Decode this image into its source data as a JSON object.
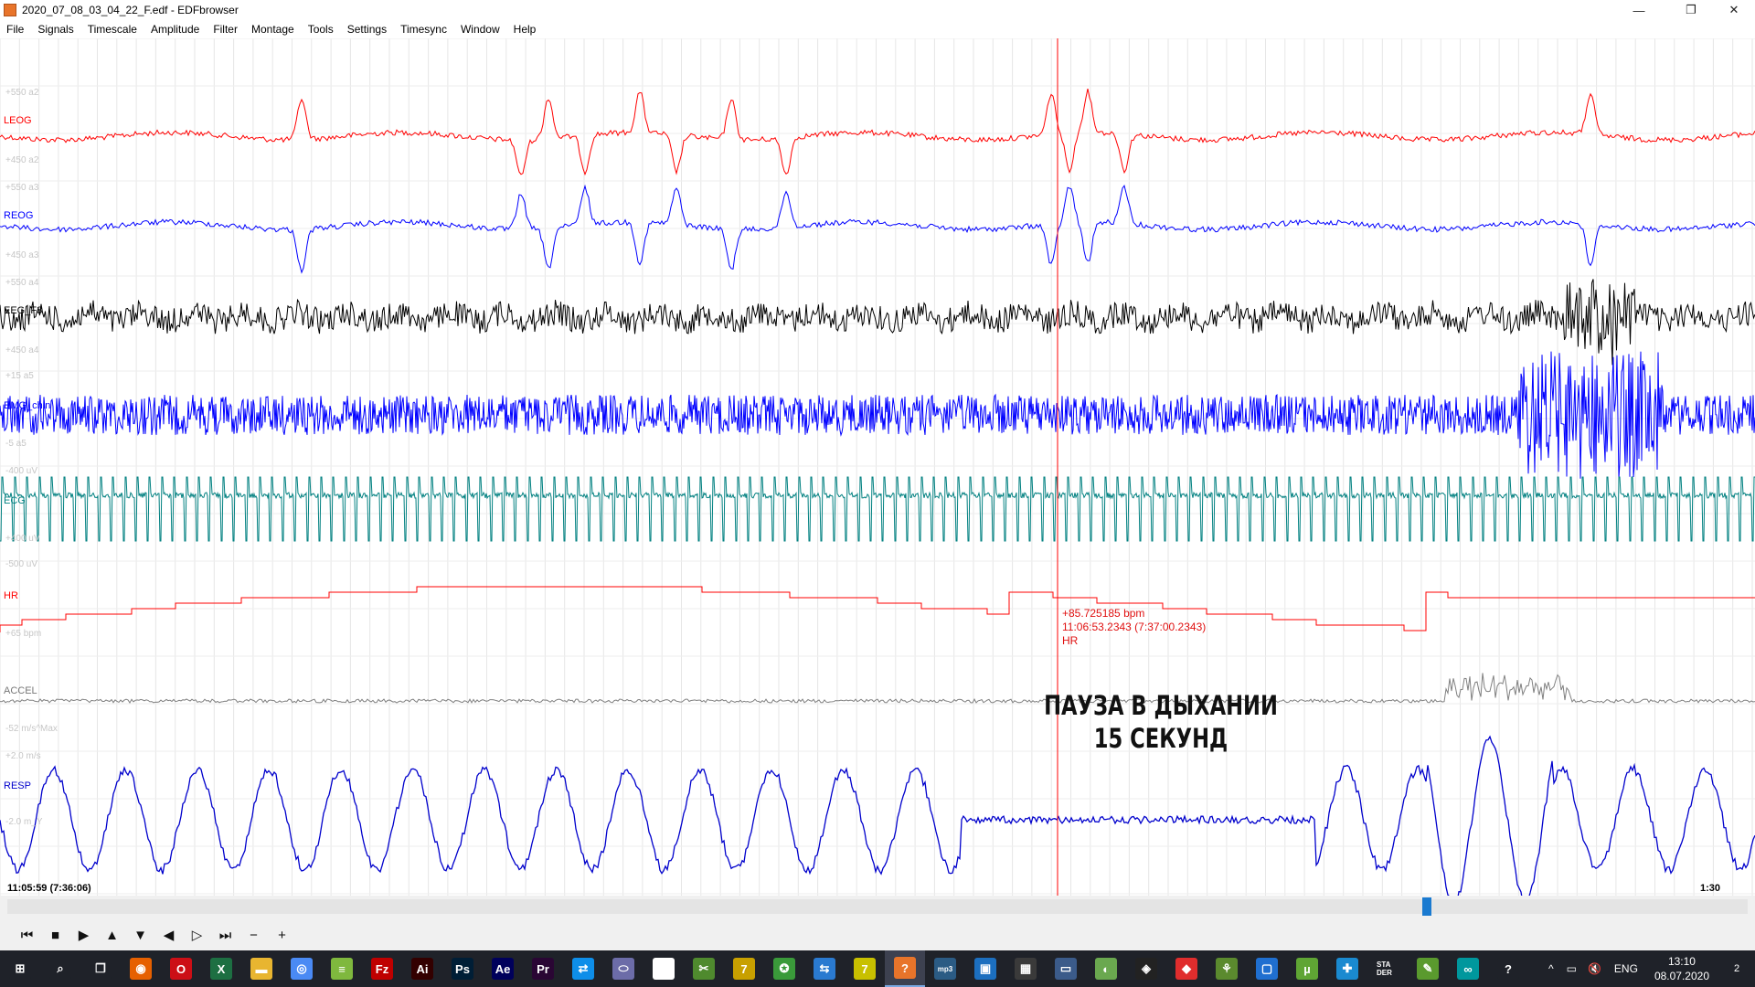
{
  "window": {
    "title": "2020_07_08_03_04_22_F.edf - EDFbrowser",
    "minimize_glyph": "—",
    "restore_glyph": "❐",
    "close_glyph": "✕"
  },
  "menu": [
    {
      "label": "File"
    },
    {
      "label": "Signals"
    },
    {
      "label": "Timescale"
    },
    {
      "label": "Amplitude"
    },
    {
      "label": "Filter"
    },
    {
      "label": "Montage"
    },
    {
      "label": "Tools"
    },
    {
      "label": "Settings"
    },
    {
      "label": "Timesync"
    },
    {
      "label": "Window"
    },
    {
      "label": "Help"
    }
  ],
  "signals": [
    {
      "label": "LEOG",
      "color": "#ff0000"
    },
    {
      "label": "REOG",
      "color": "#0000ff"
    },
    {
      "label": "EEG_F3",
      "color": "#000000"
    },
    {
      "label": "EMG_chin",
      "color": "#0000ff"
    },
    {
      "label": "ECG",
      "color": "#008080"
    },
    {
      "label": "HR",
      "color": "#ff0000"
    },
    {
      "label": "ACCEL",
      "color": "#808080"
    },
    {
      "label": "RESP",
      "color": "#0000cc"
    }
  ],
  "scale_labels": [
    "+550 a2",
    "+450 a2",
    "+550 a3",
    "+450 a3",
    "+550 a4",
    "+450 a4",
    "+15 a5",
    "-5 a5",
    "-400 uV",
    "+400 uV",
    "-500 uV",
    "+65 bpm",
    "-52 m/s^Max",
    "+2.0 m/s",
    "-2.0 m_Y"
  ],
  "hr_readout": {
    "value": "+85.725185 bpm",
    "time": "11:06:53.2343 (7:37:00.2343)",
    "signal": "HR"
  },
  "annotation": {
    "line1": "ПАУЗА В ДЫХАНИИ",
    "line2": "15 СЕКУНД"
  },
  "timeline": {
    "start": "11:05:59 (7:36:06)",
    "page_length": "1:30",
    "scroll_position_fraction": 0.81
  },
  "controls": [
    "⏮",
    "■",
    "▶",
    "▲",
    "▼",
    "◀",
    "▷",
    "⏭",
    "−",
    "+"
  ],
  "taskbar": {
    "apps": [
      {
        "name": "windows-start-icon",
        "color": "#1f2229",
        "glyph": "⊞"
      },
      {
        "name": "search-icon",
        "color": "#1f2229",
        "glyph": "⌕"
      },
      {
        "name": "task-view-icon",
        "color": "#1f2229",
        "glyph": "❐"
      },
      {
        "name": "firefox-icon",
        "color": "#e66000",
        "glyph": "◉"
      },
      {
        "name": "opera-icon",
        "color": "#cc0f16",
        "glyph": "O"
      },
      {
        "name": "excel-icon",
        "color": "#1d6f42",
        "glyph": "X"
      },
      {
        "name": "explorer-icon",
        "color": "#e8b530",
        "glyph": "▬"
      },
      {
        "name": "chrome-icon",
        "color": "#4a8af4",
        "glyph": "◎"
      },
      {
        "name": "notepad-icon",
        "color": "#7fb83e",
        "glyph": "≡"
      },
      {
        "name": "filezilla-icon",
        "color": "#bf0000",
        "glyph": "Fz"
      },
      {
        "name": "illustrator-icon",
        "color": "#330000",
        "glyph": "Ai"
      },
      {
        "name": "photoshop-icon",
        "color": "#001e36",
        "glyph": "Ps"
      },
      {
        "name": "after-effects-icon",
        "color": "#00005b",
        "glyph": "Ae"
      },
      {
        "name": "premiere-icon",
        "color": "#2a0634",
        "glyph": "Pr"
      },
      {
        "name": "teamviewer-icon",
        "color": "#0e8ee9",
        "glyph": "⇄"
      },
      {
        "name": "media-icon",
        "color": "#6c6ca8",
        "glyph": "⬭"
      },
      {
        "name": "ve-icon",
        "color": "#ffffff",
        "glyph": "Ve"
      },
      {
        "name": "tool-icon",
        "color": "#4f8a2e",
        "glyph": "✂"
      },
      {
        "name": "sevenzip-icon",
        "color": "#c8a000",
        "glyph": "7"
      },
      {
        "name": "network-icon",
        "color": "#3a9a3a",
        "glyph": "✪"
      },
      {
        "name": "transfer-icon",
        "color": "#2a7ad0",
        "glyph": "⇆"
      },
      {
        "name": "sevenzip2-icon",
        "color": "#c8c000",
        "glyph": "7"
      },
      {
        "name": "edfbrowser-icon",
        "color": "#e8742a",
        "glyph": "?"
      },
      {
        "name": "mp3-icon",
        "color": "#2b5b84",
        "glyph": "mp3"
      },
      {
        "name": "window-icon",
        "color": "#1c6fbf",
        "glyph": "▣"
      },
      {
        "name": "calculator-icon",
        "color": "#3a3a3a",
        "glyph": "▦"
      },
      {
        "name": "display-icon",
        "color": "#3b5b8a",
        "glyph": "▭"
      },
      {
        "name": "android-icon",
        "color": "#6aa84f",
        "glyph": "◐"
      },
      {
        "name": "unity-icon",
        "color": "#222222",
        "glyph": "◈"
      },
      {
        "name": "anydesk-icon",
        "color": "#e02d2d",
        "glyph": "◆"
      },
      {
        "name": "lab-icon",
        "color": "#5b8a2e",
        "glyph": "⚘"
      },
      {
        "name": "screen-icon",
        "color": "#1f6fd0",
        "glyph": "▢"
      },
      {
        "name": "utorrent-icon",
        "color": "#5fa534",
        "glyph": "µ"
      },
      {
        "name": "puzzle-icon",
        "color": "#1a8ad0",
        "glyph": "✚"
      },
      {
        "name": "stader-icon",
        "color": "#1f2229",
        "glyph": "STA DER"
      },
      {
        "name": "edit-icon",
        "color": "#5a9a2e",
        "glyph": "✎"
      },
      {
        "name": "arduino-icon",
        "color": "#00979d",
        "glyph": "∞"
      },
      {
        "name": "help-icon",
        "color": "#1f2229",
        "glyph": "?"
      }
    ],
    "tray": {
      "arrow": "^",
      "network": "▭",
      "volume": "🔇",
      "language": "ENG",
      "time": "13:10",
      "date": "08.07.2020",
      "notifications": "2"
    }
  }
}
